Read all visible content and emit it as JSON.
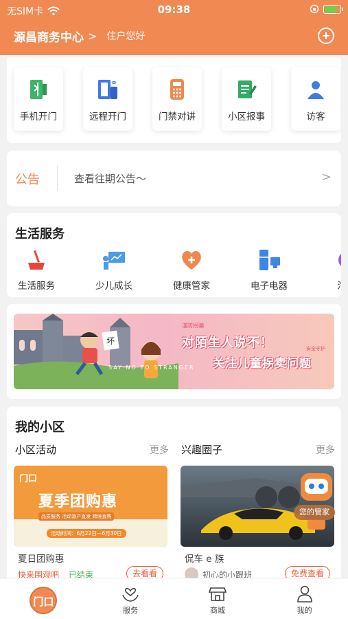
{
  "status_bar": {
    "carrier": "无SIM卡",
    "time": "09:38"
  },
  "header": {
    "community": "源昌商务中心",
    "greeting": "住户您好"
  },
  "quick_actions": [
    {
      "label": "手机开门",
      "icon": "phone-door-icon"
    },
    {
      "label": "远程开门",
      "icon": "remote-door-icon"
    },
    {
      "label": "门禁对讲",
      "icon": "intercom-icon"
    },
    {
      "label": "小区报事",
      "icon": "report-icon"
    },
    {
      "label": "访客",
      "icon": "visitor-icon"
    }
  ],
  "notice": {
    "title": "公告",
    "text": "查看往期公告～"
  },
  "life_services": {
    "title": "生活服务",
    "items": [
      {
        "label": "生活服务",
        "icon": "cleaning-icon"
      },
      {
        "label": "少儿成长",
        "icon": "teaching-icon"
      },
      {
        "label": "健康管家",
        "icon": "health-heart-icon"
      },
      {
        "label": "电子电器",
        "icon": "appliance-icon"
      },
      {
        "label": "汽车",
        "icon": "car-service-icon"
      }
    ]
  },
  "banner": {
    "small_top": "谨防拐骗",
    "line1": "对陌生人说不！",
    "line2": "关注儿童拐卖问题",
    "small_side": "安全守护",
    "slogan": "SAY NO TO STRANGER",
    "sign": "坏"
  },
  "my_community": {
    "title": "我的小区",
    "activities": {
      "title": "小区活动",
      "more": "更多",
      "promo": {
        "logo": "门口",
        "title": "夏季团购惠",
        "tags": "品质服务  活动源产直发  跨境直购",
        "date": "活动时间：6月22日—6月30日"
      },
      "name": "夏日团购惠",
      "sub": "快来围观吧",
      "status": "已结束",
      "button": "去看看"
    },
    "interests": {
      "title": "兴趣圈子",
      "more": "更多",
      "name": "侃车 e 族",
      "user": "初心的小跟班",
      "button": "免费查看"
    },
    "butler": "您的管家"
  },
  "tabbar": {
    "home": "门口",
    "tabs": [
      "服务",
      "商城",
      "我的"
    ]
  },
  "colors": {
    "accent": "#f08a52",
    "warning": "#f05a3a",
    "success": "#3cb44a"
  }
}
